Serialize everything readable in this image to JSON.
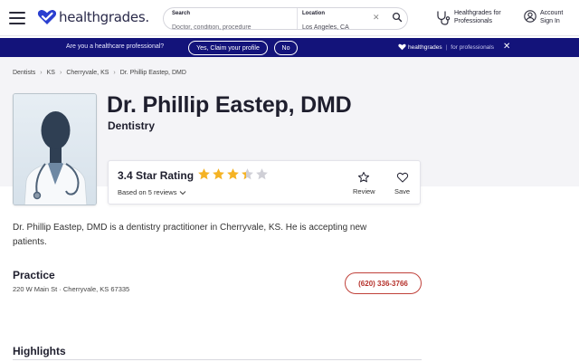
{
  "header": {
    "logo_text": "healthgrades.",
    "search": {
      "term_label": "Search",
      "term_placeholder": "Doctor, condition, procedure",
      "location_label": "Location",
      "location_value": "Los Angeles, CA"
    },
    "pro_link": "Healthgrades for Professionals",
    "account_link": "Account Sign In"
  },
  "promo": {
    "question": "Are you a healthcare professional?",
    "claim_button": "Yes, Claim your profile",
    "no_button": "No",
    "brand": "healthgrades",
    "brand_suffix": "for professionals"
  },
  "breadcrumb": [
    "Dentists",
    "KS",
    "Cherryvale, KS",
    "Dr. Phillip Eastep, DMD"
  ],
  "profile": {
    "name": "Dr. Phillip Eastep, DMD",
    "specialty": "Dentistry",
    "rating_title": "3.4 Star Rating",
    "rating_value": 3.4,
    "rating_max": 5,
    "reviews_link": "Based on 5 reviews",
    "review_action": "Review",
    "save_action": "Save"
  },
  "summary": "Dr. Phillip Eastep, DMD is a dentistry practitioner in Cherryvale, KS. He is accepting new patients.",
  "practice": {
    "title": "Practice",
    "address": "220 W Main St · Cherryvale, KS 67335",
    "phone": "(620) 336-3766"
  },
  "highlights_title": "Highlights",
  "colors": {
    "brand_navy": "#13137a",
    "star": "#f5b324",
    "star_empty": "#cfcfd6",
    "phone_red": "#b5302a"
  }
}
